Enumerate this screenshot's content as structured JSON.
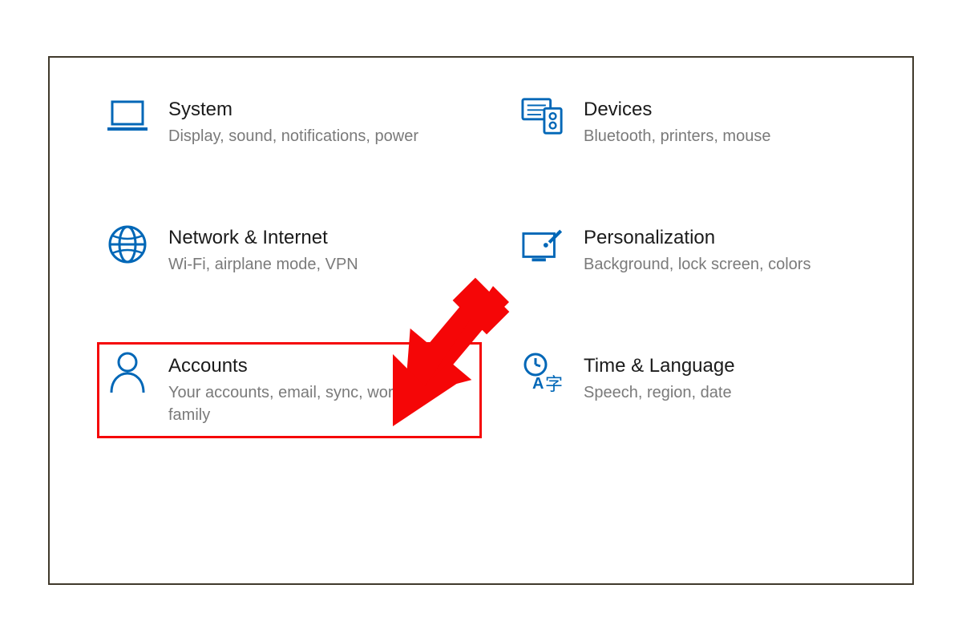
{
  "colors": {
    "accent": "#0067b7",
    "highlight": "#f50607"
  },
  "tiles": [
    {
      "id": "system",
      "title": "System",
      "subtitle": "Display, sound, notifications, power"
    },
    {
      "id": "devices",
      "title": "Devices",
      "subtitle": "Bluetooth, printers, mouse"
    },
    {
      "id": "network",
      "title": "Network & Internet",
      "subtitle": "Wi-Fi, airplane mode, VPN"
    },
    {
      "id": "personalization",
      "title": "Personalization",
      "subtitle": "Background, lock screen, colors"
    },
    {
      "id": "accounts",
      "title": "Accounts",
      "subtitle": "Your accounts, email, sync, work, family",
      "highlighted": true
    },
    {
      "id": "time",
      "title": "Time & Language",
      "subtitle": "Speech, region, date"
    }
  ]
}
